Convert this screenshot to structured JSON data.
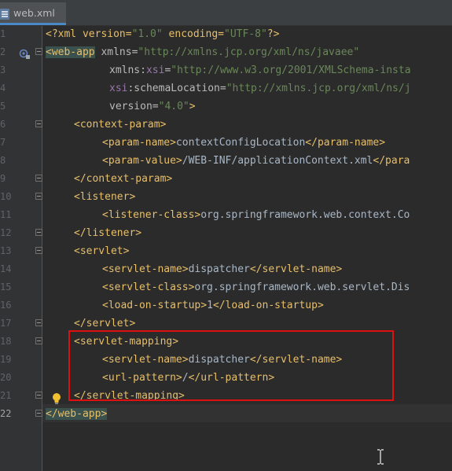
{
  "tab": {
    "label": "web.xml",
    "icon": "xml-file-icon"
  },
  "gutter": {
    "line_numbers": [
      "1",
      "2",
      "3",
      "4",
      "5",
      "6",
      "7",
      "8",
      "9",
      "10",
      "11",
      "12",
      "13",
      "14",
      "15",
      "16",
      "17",
      "18",
      "19",
      "20",
      "21",
      "22"
    ],
    "current_line": "22"
  },
  "code": {
    "l1": {
      "open": "<?xml version=",
      "v1": "\"1.0\"",
      "mid": " encoding=",
      "v2": "\"UTF-8\"",
      "close": "?>"
    },
    "l2": {
      "tag": "<web-app",
      "attr": " xmlns=",
      "val": "\"http://xmlns.jcp.org/xml/ns/javaee\""
    },
    "l3": {
      "attr": "xmlns:",
      "ns": "xsi",
      "eq": "=",
      "val": "\"http://www.w3.org/2001/XMLSchema-insta"
    },
    "l4": {
      "ns": "xsi",
      "attr": ":schemaLocation=",
      "val": "\"http://xmlns.jcp.org/xml/ns/j"
    },
    "l5": {
      "attr": "version=",
      "val": "\"4.0\"",
      "close": ">"
    },
    "l6": {
      "tag": "<context-param>"
    },
    "l7": {
      "open": "<param-name>",
      "text": "contextConfigLocation",
      "close": "</param-name>"
    },
    "l8": {
      "open": "<param-value>",
      "text": "/WEB-INF/applicationContext.xml",
      "close": "</para"
    },
    "l9": {
      "tag": "</context-param>"
    },
    "l10": {
      "tag": "<listener>"
    },
    "l11": {
      "open": "<listener-class>",
      "text": "org.springframework.web.context.Co"
    },
    "l12": {
      "tag": "</listener>"
    },
    "l13": {
      "tag": "<servlet>"
    },
    "l14": {
      "open": "<servlet-name>",
      "text": "dispatcher",
      "close": "</servlet-name>"
    },
    "l15": {
      "open": "<servlet-class>",
      "text": "org.springframework.web.servlet.Dis"
    },
    "l16": {
      "open": "<load-on-startup>",
      "text": "1",
      "close": "</load-on-startup>"
    },
    "l17": {
      "tag": "</servlet>"
    },
    "l18": {
      "tag": "<servlet-mapping>"
    },
    "l19": {
      "open": "<servlet-name>",
      "text": "dispatcher",
      "close": "</servlet-name>"
    },
    "l20": {
      "open": "<url-pattern>",
      "text": "/",
      "close": "</url-pattern>"
    },
    "l21": {
      "tag": "</servlet-mapping>"
    },
    "l22": {
      "tag": "</web-app>"
    }
  },
  "colors": {
    "tag": "#e8bf6a",
    "attribute": "#bababa",
    "namespace": "#9876aa",
    "value": "#6a8759",
    "text": "#a9b7c6",
    "annotation": "#e01010"
  }
}
